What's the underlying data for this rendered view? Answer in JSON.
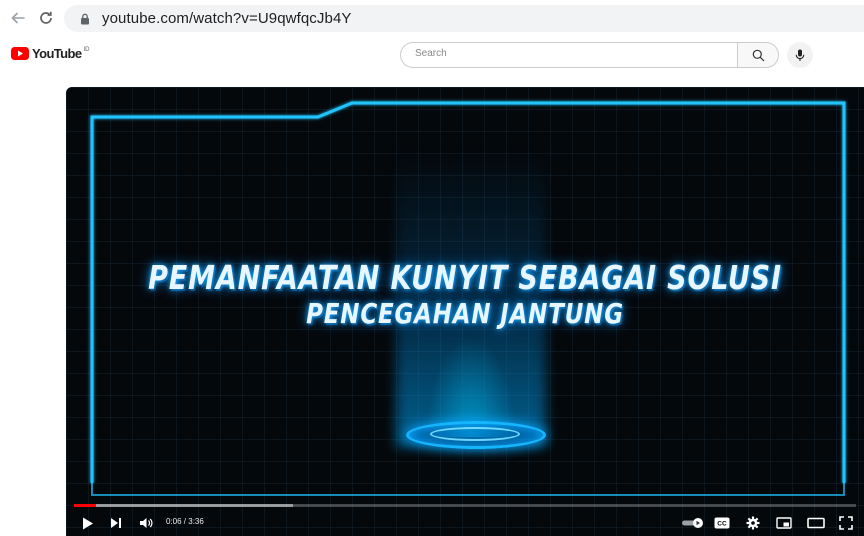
{
  "browser": {
    "url": "youtube.com/watch?v=U9qwfqcJb4Y",
    "icons": [
      "back-arrow-icon",
      "reload-icon",
      "lock-icon"
    ]
  },
  "header": {
    "logo_text": "YouTube",
    "logo_reg": "ID",
    "search_placeholder": "Search",
    "colors": {
      "brand_red": "#ff0000"
    }
  },
  "video": {
    "title_line1": "Pemanfaatan Kunyit sebagai solusi",
    "title_line2": "pencegahan jantung",
    "current_time": "0:06",
    "duration": "3:36",
    "time_display": "0:06 / 3:36",
    "progress_fraction": 0.028,
    "colors": {
      "glow": "#19a9ff",
      "frame": "#21c4ff",
      "progress": "#ff0000"
    }
  },
  "controls": {
    "icons": [
      "play-icon",
      "next-icon",
      "volume-icon",
      "autoplay-toggle",
      "subtitles-icon",
      "settings-icon",
      "miniplayer-icon",
      "theater-icon",
      "fullscreen-icon"
    ],
    "cc_label": "CC"
  }
}
